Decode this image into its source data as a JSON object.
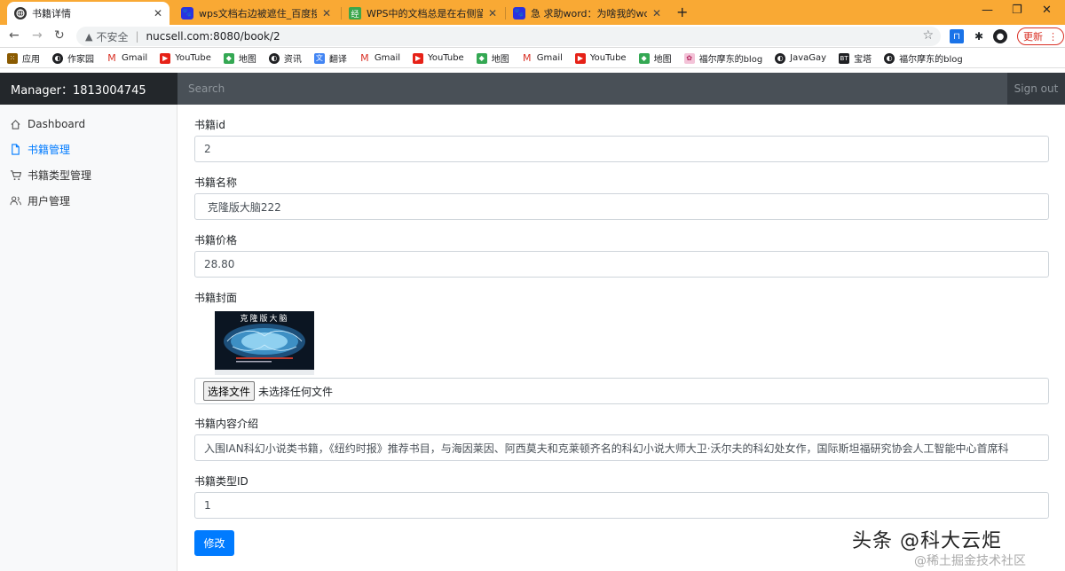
{
  "browser": {
    "tabs": [
      {
        "title": "书籍详情",
        "active": true,
        "icon": "globe-icon"
      },
      {
        "title": "wps文档右边被遮住_百度搜索",
        "active": false,
        "icon": "baidu-icon"
      },
      {
        "title": "WPS中的文档总是在右侧留下空白",
        "active": false,
        "icon": "jingyan-icon"
      },
      {
        "title": "急 求助word：为啥我的word打...",
        "active": false,
        "icon": "baidu-icon"
      }
    ],
    "new_tab_glyph": "+",
    "address": {
      "insecure_label": "不安全",
      "separator": "|",
      "url": "nucsell.com:8080/book/2"
    },
    "update_label": "更新",
    "bookmarks": [
      {
        "label": "应用",
        "icon": "apps-icon"
      },
      {
        "label": "作家园",
        "icon": "zuojiayuan-icon"
      },
      {
        "label": "Gmail",
        "icon": "gmail-icon"
      },
      {
        "label": "YouTube",
        "icon": "youtube-icon"
      },
      {
        "label": "地图",
        "icon": "maps-icon"
      },
      {
        "label": "资讯",
        "icon": "news-icon"
      },
      {
        "label": "翻译",
        "icon": "translate-icon"
      },
      {
        "label": "Gmail",
        "icon": "gmail-icon"
      },
      {
        "label": "YouTube",
        "icon": "youtube-icon"
      },
      {
        "label": "地图",
        "icon": "maps-icon"
      },
      {
        "label": "Gmail",
        "icon": "gmail-icon"
      },
      {
        "label": "YouTube",
        "icon": "youtube-icon"
      },
      {
        "label": "地图",
        "icon": "maps-icon"
      },
      {
        "label": "福尔摩东的blog",
        "icon": "blog-icon"
      },
      {
        "label": "JavaGay",
        "icon": "javagay-icon"
      },
      {
        "label": "宝塔",
        "icon": "bt-icon"
      },
      {
        "label": "福尔摩东的blog",
        "icon": "blog-icon"
      }
    ]
  },
  "app": {
    "brand": "Manager：1813004745",
    "search_placeholder": "Search",
    "signout": "Sign out"
  },
  "sidebar": {
    "items": [
      {
        "label": "Dashboard",
        "icon": "home-icon",
        "active": false
      },
      {
        "label": "书籍管理",
        "icon": "file-icon",
        "active": true
      },
      {
        "label": "书籍类型管理",
        "icon": "cart-icon",
        "active": false
      },
      {
        "label": "用户管理",
        "icon": "users-icon",
        "active": false
      }
    ]
  },
  "form": {
    "id_label": "书籍id",
    "id_value": "2",
    "name_label": "书籍名称",
    "name_value": " 克隆版大脑222",
    "price_label": "书籍价格",
    "price_value": "28.80",
    "cover_label": "书籍封面",
    "cover_title": "克隆版大脑",
    "file_button": "选择文件",
    "file_status": "未选择任何文件",
    "desc_label": "书籍内容介绍",
    "desc_value": "入围IAN科幻小说类书籍，《纽约时报》推荐书目，与海因莱因、阿西莫夫和克莱顿齐名的科幻小说大师大卫·沃尔夫的科幻处女作，国际斯坦福研究协会人工智能中心首席科",
    "type_label": "书籍类型ID",
    "type_value": "1",
    "submit": "修改"
  },
  "watermark": {
    "main": "头条 @科大云炬",
    "sub": "@稀土掘金技术社区"
  },
  "colors": {
    "tabbar": "#f9a934",
    "navbar": "#343a40",
    "primary": "#007bff"
  }
}
